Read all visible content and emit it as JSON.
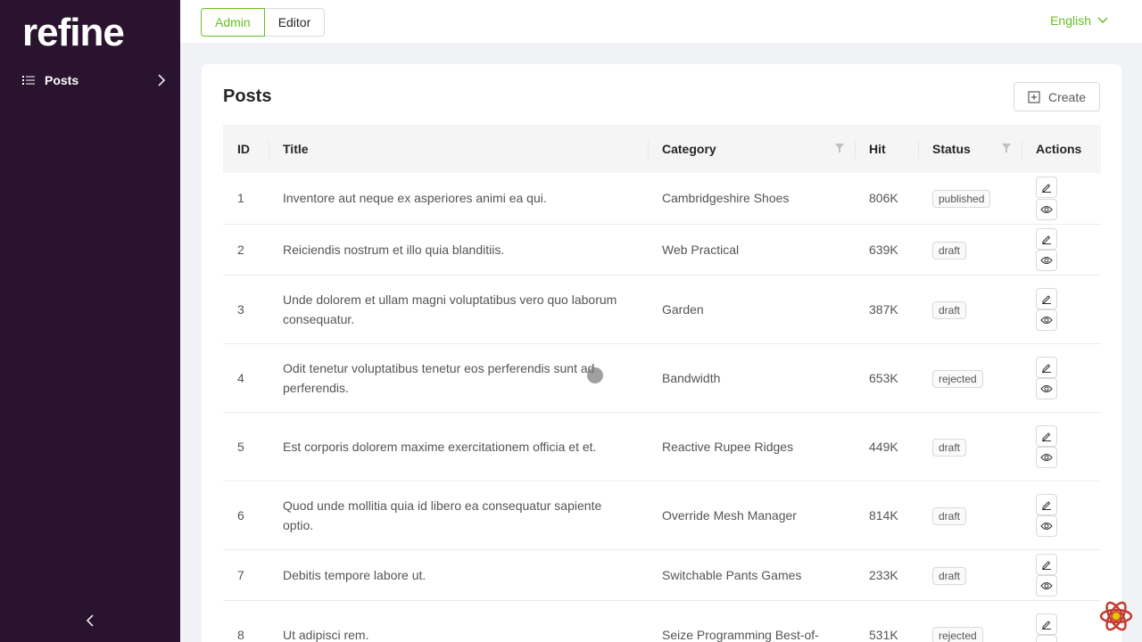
{
  "brand": {
    "logo_text": "refine"
  },
  "sidebar": {
    "items": [
      {
        "label": "Posts",
        "icon": "list-icon"
      }
    ],
    "collapse_icon": "chevron-left-icon"
  },
  "header": {
    "roles": [
      "Admin",
      "Editor"
    ],
    "active_role": "Admin",
    "language": "English"
  },
  "page": {
    "title": "Posts",
    "create_label": "Create"
  },
  "table": {
    "columns": [
      "ID",
      "Title",
      "Category",
      "Hit",
      "Status",
      "Actions"
    ],
    "rows": [
      {
        "id": "1",
        "title": "Inventore aut neque ex asperiores animi ea qui.",
        "category": "Cambridgeshire Shoes",
        "hit": "806K",
        "status": "published"
      },
      {
        "id": "2",
        "title": "Reiciendis nostrum et illo quia blanditiis.",
        "category": "Web Practical",
        "hit": "639K",
        "status": "draft"
      },
      {
        "id": "3",
        "title": "Unde dolorem et ullam magni voluptatibus vero quo laborum consequatur.",
        "category": "Garden",
        "hit": "387K",
        "status": "draft"
      },
      {
        "id": "4",
        "title": "Odit tenetur voluptatibus tenetur eos perferendis sunt ad perferendis.",
        "category": "Bandwidth",
        "hit": "653K",
        "status": "rejected"
      },
      {
        "id": "5",
        "title": "Est corporis dolorem maxime exercitationem officia et et.",
        "category": "Reactive Rupee Ridges",
        "hit": "449K",
        "status": "draft"
      },
      {
        "id": "6",
        "title": "Quod unde mollitia quia id libero ea consequatur sapiente optio.",
        "category": "Override Mesh Manager",
        "hit": "814K",
        "status": "draft"
      },
      {
        "id": "7",
        "title": "Debitis tempore labore ut.",
        "category": "Switchable Pants Games",
        "hit": "233K",
        "status": "draft"
      },
      {
        "id": "8",
        "title": "Ut adipisci rem.",
        "category": "Seize Programming Best-of-",
        "hit": "531K",
        "status": "rejected"
      }
    ]
  },
  "colors": {
    "sidebar_bg": "#2a132e",
    "accent": "#67be23"
  }
}
